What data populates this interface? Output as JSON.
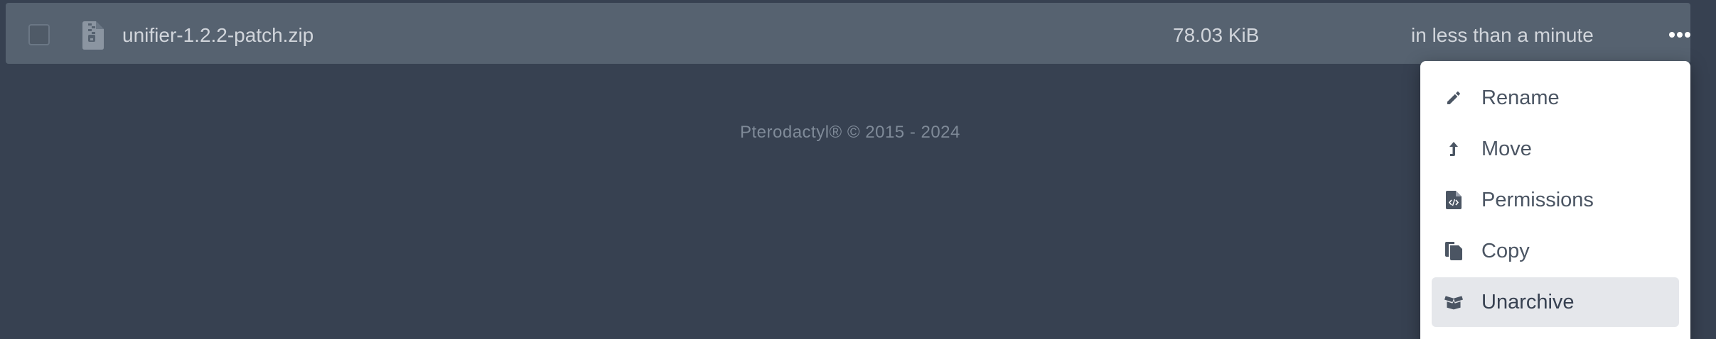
{
  "file": {
    "name": "unifier-1.2.2-patch.zip",
    "size": "78.03 KiB",
    "modified": "in less than a minute",
    "icon": "file-archive-icon"
  },
  "footer": {
    "text": "Pterodactyl® © 2015 - 2024"
  },
  "context_menu": {
    "items": [
      {
        "label": "Rename",
        "icon": "pencil-icon"
      },
      {
        "label": "Move",
        "icon": "level-up-icon"
      },
      {
        "label": "Permissions",
        "icon": "file-code-icon"
      },
      {
        "label": "Copy",
        "icon": "copy-icon"
      },
      {
        "label": "Unarchive",
        "icon": "box-open-icon",
        "highlighted": true
      }
    ]
  },
  "colors": {
    "background": "#374151",
    "row": "#566270",
    "menu_bg": "#ffffff",
    "menu_highlight": "#e5e7eb",
    "text_light": "#d1d5db",
    "text_dark": "#4b5563"
  }
}
